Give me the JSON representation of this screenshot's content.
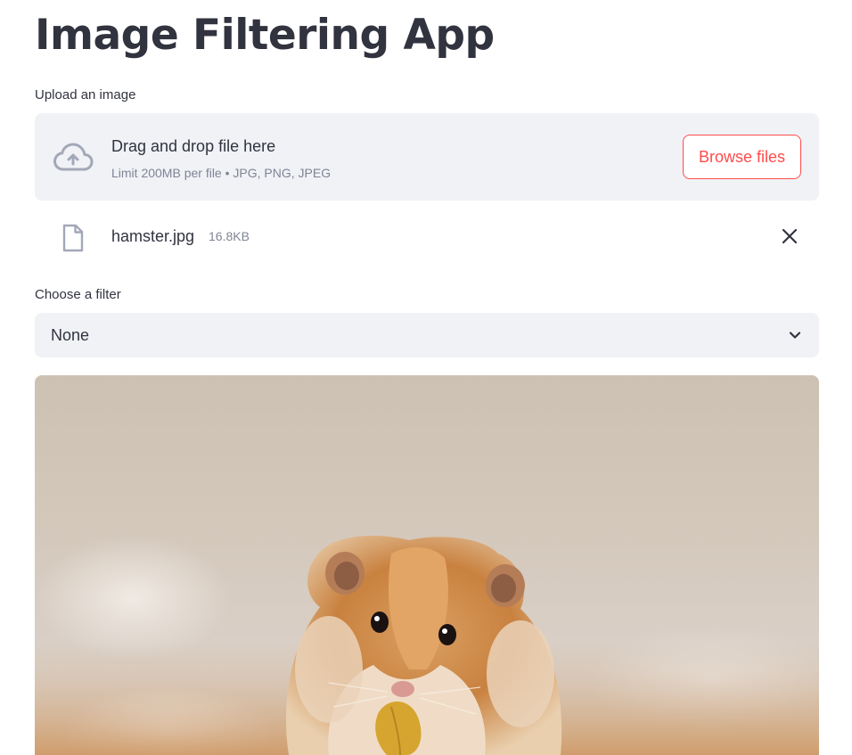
{
  "header": {
    "title": "Image Filtering App"
  },
  "uploader": {
    "label": "Upload an image",
    "drop_title": "Drag and drop file here",
    "limit_text": "Limit 200MB per file • JPG, PNG, JPEG",
    "browse_label": "Browse files",
    "icon": "cloud-upload-icon"
  },
  "uploaded_file": {
    "name": "hamster.jpg",
    "size": "16.8KB",
    "icon": "file-icon",
    "remove_icon": "close-icon"
  },
  "filter": {
    "label": "Choose a filter",
    "selected": "None",
    "icon": "chevron-down-icon"
  },
  "image": {
    "subject": "hamster-photo"
  },
  "colors": {
    "accent": "#ff4b4b",
    "text": "#31333f",
    "muted": "#808495",
    "widget_bg": "#f0f2f6"
  }
}
